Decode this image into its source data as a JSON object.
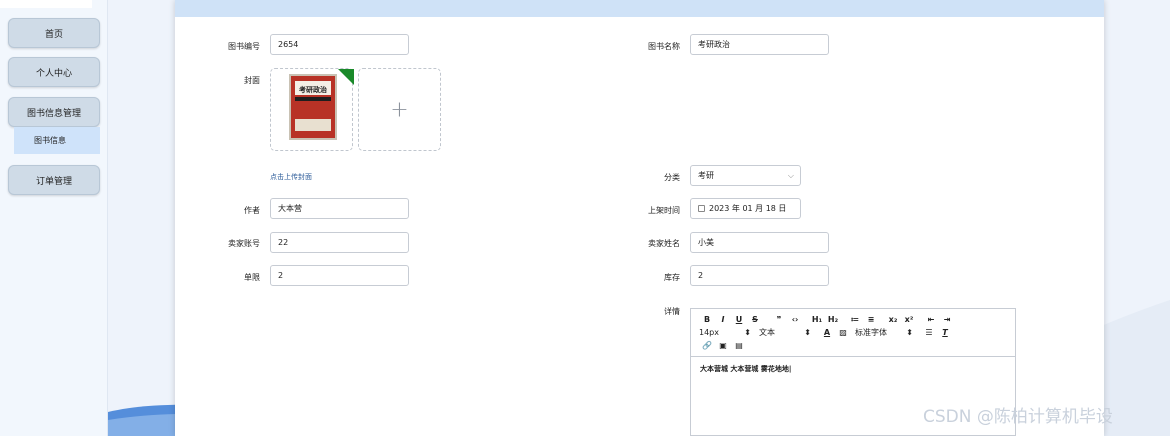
{
  "sidebar": {
    "items": [
      {
        "label": "首页"
      },
      {
        "label": "个人中心"
      },
      {
        "label": "图书信息管理"
      },
      {
        "label": "订单管理"
      }
    ],
    "sub_item": "图书信息"
  },
  "form": {
    "book_no": {
      "label": "图书编号",
      "value": "2654"
    },
    "book_name": {
      "label": "图书名称",
      "value": "考研政治"
    },
    "cover": {
      "label": "封面",
      "hint": "点击上传封面",
      "plus": "+",
      "cover_text": "考研政治"
    },
    "category": {
      "label": "分类",
      "value": "考研"
    },
    "author": {
      "label": "作者",
      "value": "大本营"
    },
    "shelf_time": {
      "label": "上架时间",
      "value": "2023 年 01 月 18 日"
    },
    "seller_account": {
      "label": "卖家账号",
      "value": "22"
    },
    "seller_name": {
      "label": "卖家姓名",
      "value": "小美"
    },
    "limit": {
      "label": "单限",
      "value": "2"
    },
    "stock": {
      "label": "库存",
      "value": "2"
    },
    "detail": {
      "label": "详情"
    }
  },
  "editor": {
    "row1": [
      "B",
      "I",
      "U",
      "S",
      "❞",
      "‹›",
      "H₁",
      "H₂",
      "≔",
      "≡",
      "x₂",
      "x²",
      "⇤",
      "⇥"
    ],
    "font_size": "14px",
    "text_style": "文本",
    "font_family": "标准字体",
    "content": "大本营城 大本营城 雾花地地"
  },
  "watermark": "CSDN @陈柏计算机毕设",
  "colors": {
    "header": "#cfe2f7",
    "nav_button": "#cfdbe7",
    "nav_sub": "#cfe3fa",
    "link": "#2d5c9a"
  }
}
